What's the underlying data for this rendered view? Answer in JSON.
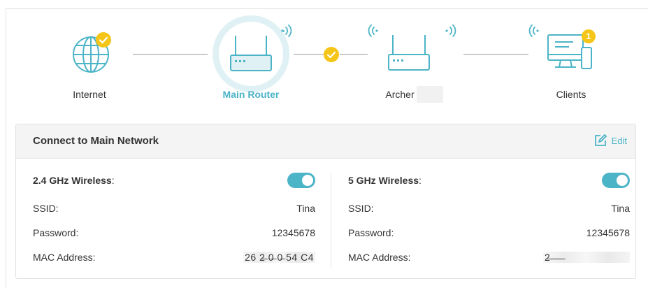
{
  "topology": {
    "nodes": [
      {
        "label": "Internet",
        "icon": "globe-icon",
        "status": "check-badge"
      },
      {
        "label": "Main Router",
        "icon": "router-icon",
        "active": true
      },
      {
        "label": "Archer",
        "icon": "router-icon"
      },
      {
        "label": "Clients",
        "icon": "clients-icon",
        "badge": "1"
      }
    ],
    "colors": {
      "accent": "#4cb4c7",
      "badge": "#f5c518",
      "line": "#9a9a9a"
    }
  },
  "panel": {
    "title": "Connect to Main Network",
    "edit_label": "Edit",
    "band_24": {
      "title": "2.4 GHz Wireless",
      "title_suffix": ":",
      "enabled": true,
      "ssid_label": "SSID:",
      "ssid": "Tina",
      "password_label": "Password:",
      "password": "12345678",
      "mac_label": "MAC Address:",
      "mac": "26 2̶ 0̶ 0̶ 54 C4"
    },
    "band_5": {
      "title": "5 GHz Wireless",
      "title_suffix": ":",
      "enabled": true,
      "ssid_label": "SSID:",
      "ssid": "Tina",
      "password_label": "Password:",
      "password": "12345678",
      "mac_label": "MAC Address:",
      "mac": "2̶ ̶ ̶ ̶ ̶"
    }
  }
}
